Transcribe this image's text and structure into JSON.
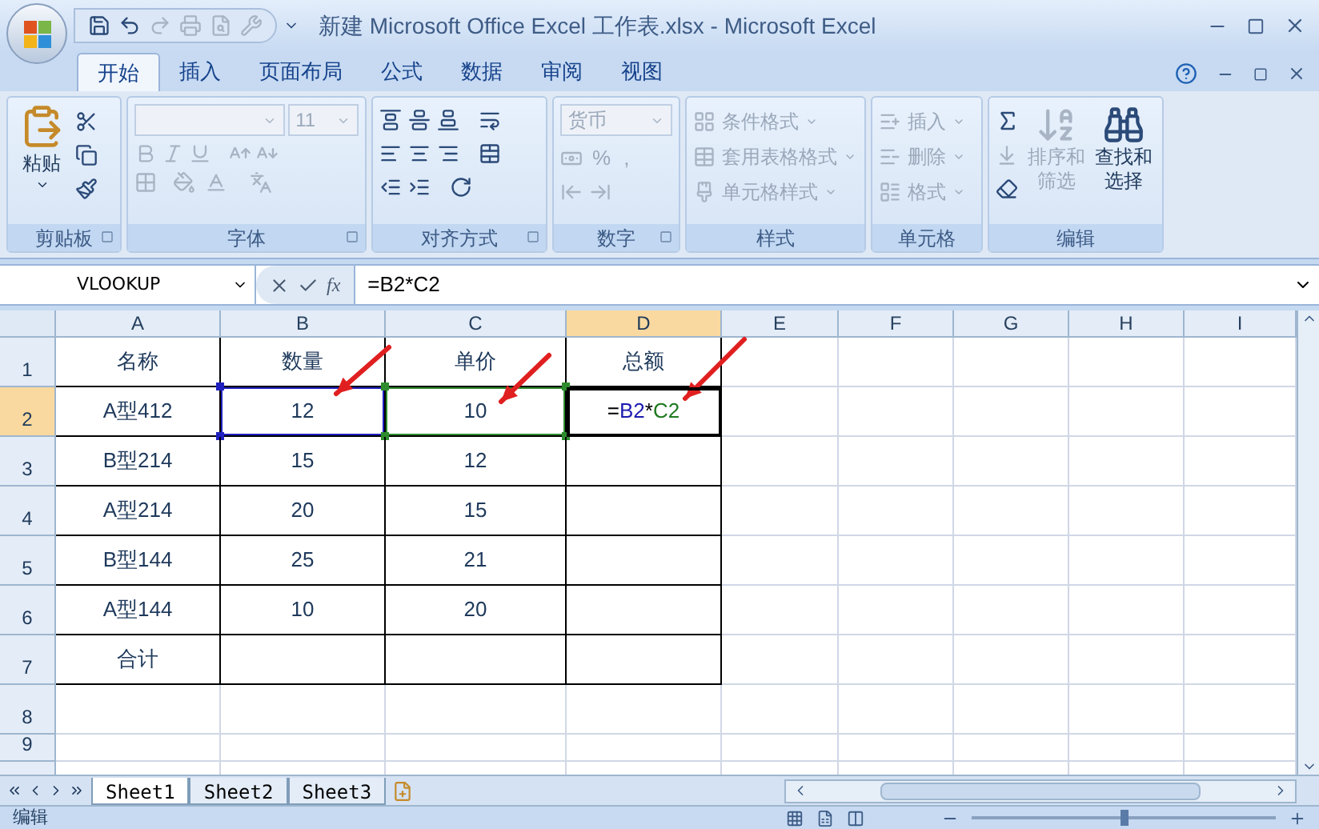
{
  "window": {
    "title": "新建 Microsoft Office Excel 工作表.xlsx - Microsoft Excel"
  },
  "ribbon_tabs": [
    {
      "label": "开始",
      "selected": true
    },
    {
      "label": "插入",
      "selected": false
    },
    {
      "label": "页面布局",
      "selected": false
    },
    {
      "label": "公式",
      "selected": false
    },
    {
      "label": "数据",
      "selected": false
    },
    {
      "label": "审阅",
      "selected": false
    },
    {
      "label": "视图",
      "selected": false
    }
  ],
  "clipboard": {
    "label": "剪贴板",
    "paste": "粘贴"
  },
  "font": {
    "label": "字体",
    "size": "11",
    "disabled": true
  },
  "alignment": {
    "label": "对齐方式"
  },
  "number": {
    "label": "数字",
    "format": "货币",
    "percent": "%",
    "comma": ",",
    "disabled": true
  },
  "styles": {
    "label": "样式",
    "items": [
      {
        "label": "条件格式",
        "disabled": true
      },
      {
        "label": "套用表格格式",
        "disabled": true
      },
      {
        "label": "单元格样式",
        "disabled": true
      }
    ]
  },
  "cells_group": {
    "label": "单元格",
    "items": [
      {
        "label": "插入",
        "disabled": true
      },
      {
        "label": "删除",
        "disabled": true
      },
      {
        "label": "格式",
        "disabled": true
      }
    ]
  },
  "editing": {
    "label": "编辑",
    "items": [
      {
        "label": "排序和筛选",
        "disabled": true
      },
      {
        "label": "查找和选择",
        "disabled": false
      }
    ]
  },
  "formula_bar": {
    "name_box": "VLOOKUP",
    "fx": "fx",
    "formula": "=B2*C2"
  },
  "columns": [
    {
      "label": "A",
      "selected": false
    },
    {
      "label": "B",
      "selected": false
    },
    {
      "label": "C",
      "selected": false
    },
    {
      "label": "D",
      "selected": true
    },
    {
      "label": "E",
      "selected": false
    },
    {
      "label": "F",
      "selected": false
    },
    {
      "label": "G",
      "selected": false
    },
    {
      "label": "H",
      "selected": false
    },
    {
      "label": "I",
      "selected": false
    }
  ],
  "rows": [
    {
      "label": "1",
      "selected": false,
      "cells": [
        {
          "text": "名称",
          "selected": false
        },
        {
          "text": "数量",
          "selected": false
        },
        {
          "text": "单价",
          "selected": false
        },
        {
          "text": "总额",
          "selected": false
        }
      ]
    },
    {
      "label": "2",
      "selected": true,
      "cells": [
        {
          "text": "A型412",
          "selected": false
        },
        {
          "text": "12",
          "selected": false,
          "color": "#2020c0"
        },
        {
          "text": "10",
          "selected": false,
          "color": "#2e8b2e"
        },
        {
          "parts": [
            {
              "text": "=",
              "color": "#000000"
            },
            {
              "text": "B2",
              "color": "#1b1bb0"
            },
            {
              "text": "*",
              "color": "#000000"
            },
            {
              "text": "C2",
              "color": "#1f7a1f"
            }
          ],
          "selected": true
        }
      ]
    },
    {
      "label": "3",
      "selected": false,
      "cells": [
        {
          "text": "B型214",
          "selected": false
        },
        {
          "text": "15",
          "selected": false
        },
        {
          "text": "12",
          "selected": false
        },
        {
          "selected": false
        }
      ]
    },
    {
      "label": "4",
      "selected": false,
      "cells": [
        {
          "text": "A型214",
          "selected": false
        },
        {
          "text": "20",
          "selected": false
        },
        {
          "text": "15",
          "selected": false
        },
        {
          "selected": false
        }
      ]
    },
    {
      "label": "5",
      "selected": false,
      "cells": [
        {
          "text": "B型144",
          "selected": false
        },
        {
          "text": "25",
          "selected": false
        },
        {
          "text": "21",
          "selected": false
        },
        {
          "selected": false
        }
      ]
    },
    {
      "label": "6",
      "selected": false,
      "cells": [
        {
          "text": "A型144",
          "selected": false
        },
        {
          "text": "10",
          "selected": false
        },
        {
          "text": "20",
          "selected": false
        },
        {
          "selected": false
        }
      ]
    },
    {
      "label": "7",
      "selected": false,
      "cells": [
        {
          "text": "合计",
          "selected": false
        },
        {
          "selected": false
        },
        {
          "selected": false
        },
        {
          "selected": false
        }
      ]
    },
    {
      "label": "8",
      "selected": false
    },
    {
      "label": "9",
      "selected": false
    }
  ],
  "sheet_tabs": [
    {
      "label": "Sheet1",
      "selected": true
    },
    {
      "label": "Sheet2",
      "selected": false
    },
    {
      "label": "Sheet3",
      "selected": false
    }
  ],
  "status_bar": {
    "mode": "编辑",
    "zoom": {
      "level": 0.5
    }
  }
}
